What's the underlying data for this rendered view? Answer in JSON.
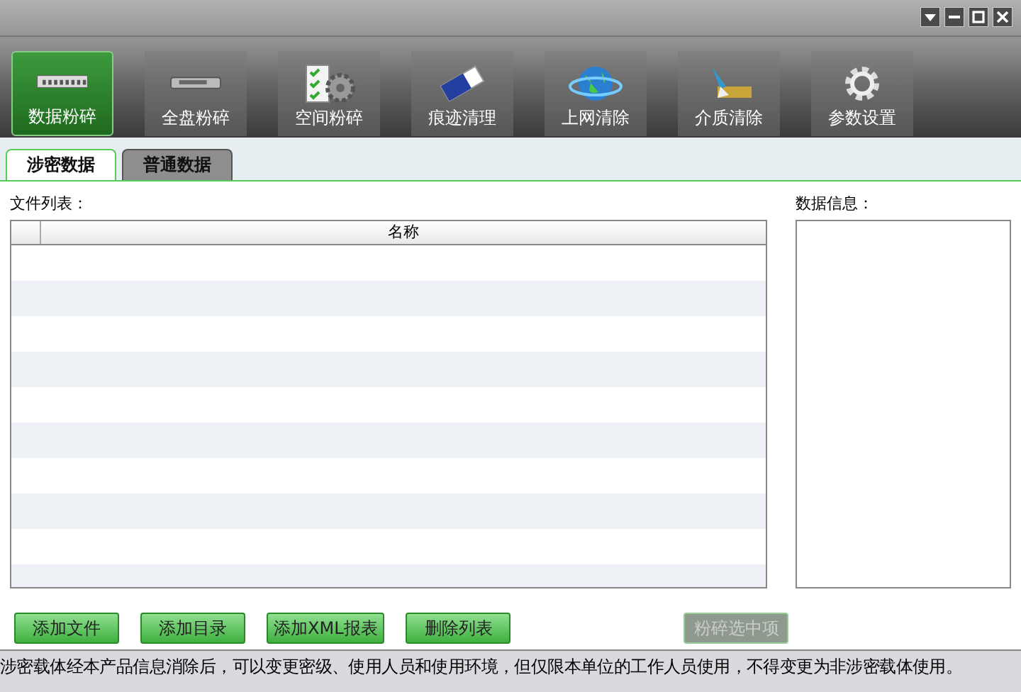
{
  "toolbar": [
    {
      "label": "数据粉碎",
      "selected": true
    },
    {
      "label": "全盘粉碎",
      "selected": false
    },
    {
      "label": "空间粉碎",
      "selected": false
    },
    {
      "label": "痕迹清理",
      "selected": false
    },
    {
      "label": "上网清除",
      "selected": false
    },
    {
      "label": "介质清除",
      "selected": false
    },
    {
      "label": "参数设置",
      "selected": false
    }
  ],
  "tabs": [
    {
      "label": "涉密数据",
      "selected": true
    },
    {
      "label": "普通数据",
      "selected": false
    }
  ],
  "file_list": {
    "label": "文件列表：",
    "columns": [
      "名称"
    ]
  },
  "data_info": {
    "label": "数据信息："
  },
  "buttons": [
    {
      "label": "添加文件",
      "disabled": false
    },
    {
      "label": "添加目录",
      "disabled": false
    },
    {
      "label": "添加XML报表",
      "disabled": false
    },
    {
      "label": "删除列表",
      "disabled": false
    },
    {
      "label": "粉碎选中项",
      "disabled": true
    }
  ],
  "status_bar": "涉密载体经本产品信息消除后，可以变更密级、使用人员和使用环境，但仅限本单位的工作人员使用，不得变更为非涉密载体使用。"
}
